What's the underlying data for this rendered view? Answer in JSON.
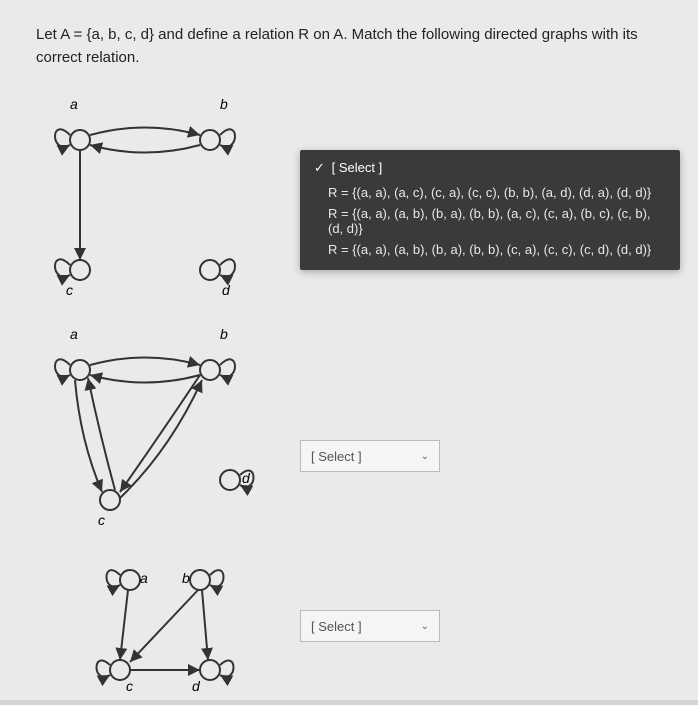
{
  "question": {
    "prompt_line1": "Let A = {a, b, c, d} and define a relation R on A. Match the following directed graphs with its",
    "prompt_line2": "correct relation."
  },
  "graphs": {
    "graph1": {
      "labels": {
        "a": "a",
        "b": "b",
        "c": "c",
        "d": "d"
      }
    },
    "graph2": {
      "labels": {
        "a": "a",
        "b": "b",
        "c": "c",
        "d": "d"
      }
    },
    "graph3": {
      "labels": {
        "a": "a",
        "b": "b",
        "c": "c",
        "d": "d"
      }
    }
  },
  "dropdown1": {
    "placeholder": "[ Select ]",
    "options": [
      "R = {(a, a), (a, c), (c, a), (c, c), (b, b), (a, d), (d, a), (d, d)}",
      "R = {(a, a), (a, b), (b, a), (b, b), (a, c), (c, a), (b, c), (c, b), (d, d)}",
      "R = {(a, a), (a, b), (b, a), (b, b), (c, a), (c, c), (c, d), (d, d)}"
    ],
    "checkmark": "✓"
  },
  "dropdown2": {
    "placeholder": "[ Select ]"
  },
  "dropdown3": {
    "placeholder": "[ Select ]"
  }
}
